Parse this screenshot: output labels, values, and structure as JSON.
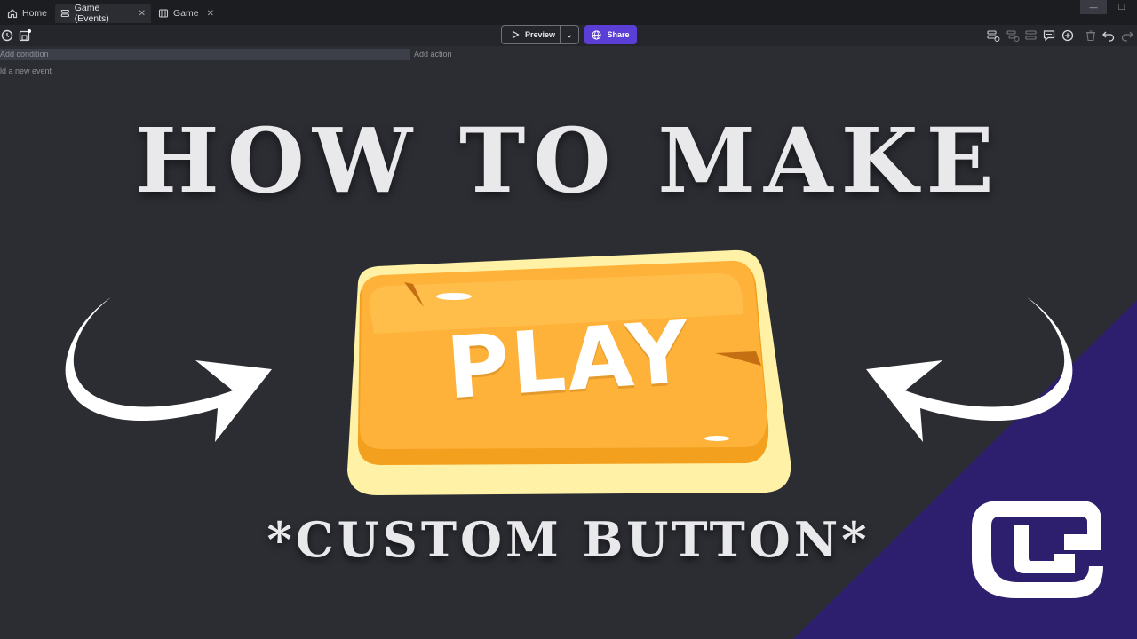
{
  "tabs": [
    {
      "label": "Home",
      "icon": "home-icon"
    },
    {
      "label": "Game (Events)",
      "icon": "events-icon",
      "active": true
    },
    {
      "label": "Game",
      "icon": "scene-icon"
    }
  ],
  "toolbar": {
    "preview_label": "Preview",
    "share_label": "Share"
  },
  "events": {
    "add_condition": "Add condition",
    "add_action": "Add action",
    "add_new_event": "ld a new event"
  },
  "thumbnail": {
    "headline": "HOW TO MAKE",
    "button_text": "PLAY",
    "subline": "*CUSTOM BUTTON*"
  },
  "colors": {
    "background": "#2b2d33",
    "accent": "#5b3ed6",
    "purple_corner": "#2e1f6e",
    "button_orange": "#ffb23a"
  }
}
